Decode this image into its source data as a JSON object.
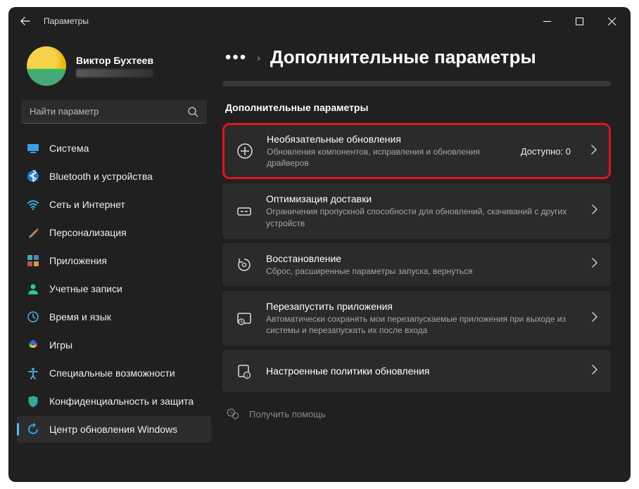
{
  "window": {
    "title": "Параметры"
  },
  "profile": {
    "name": "Виктор Бухтеев"
  },
  "search": {
    "placeholder": "Найти параметр"
  },
  "sidebar": {
    "items": [
      {
        "label": "Система",
        "icon": "system"
      },
      {
        "label": "Bluetooth и устройства",
        "icon": "bluetooth"
      },
      {
        "label": "Сеть и Интернет",
        "icon": "wifi"
      },
      {
        "label": "Персонализация",
        "icon": "personalize"
      },
      {
        "label": "Приложения",
        "icon": "apps"
      },
      {
        "label": "Учетные записи",
        "icon": "accounts"
      },
      {
        "label": "Время и язык",
        "icon": "time"
      },
      {
        "label": "Игры",
        "icon": "games"
      },
      {
        "label": "Специальные возможности",
        "icon": "accessibility"
      },
      {
        "label": "Конфиденциальность и защита",
        "icon": "privacy"
      },
      {
        "label": "Центр обновления Windows",
        "icon": "update",
        "active": true
      }
    ]
  },
  "breadcrumb": {
    "title": "Дополнительные параметры"
  },
  "section": {
    "header": "Дополнительные параметры"
  },
  "cards": [
    {
      "title": "Необязательные обновления",
      "sub": "Обновления компонентов, исправления и обновления драйверов",
      "right": "Доступно: 0",
      "highlight": true,
      "icon": "plus"
    },
    {
      "title": "Оптимизация доставки",
      "sub": "Ограничения пропускной способности для обновлений, скачиваний с других устройств",
      "icon": "delivery"
    },
    {
      "title": "Восстановление",
      "sub": "Сброс, расширенные параметры запуска, вернуться",
      "icon": "recovery"
    },
    {
      "title": "Перезапустить приложения",
      "sub": "Автоматически сохранять мои перезапускаемые приложения при выходе из системы и перезапускать их после входа",
      "icon": "restart"
    },
    {
      "title": "Настроенные политики обновления",
      "sub": "",
      "icon": "policy"
    }
  ],
  "help": {
    "label": "Получить помощь"
  }
}
